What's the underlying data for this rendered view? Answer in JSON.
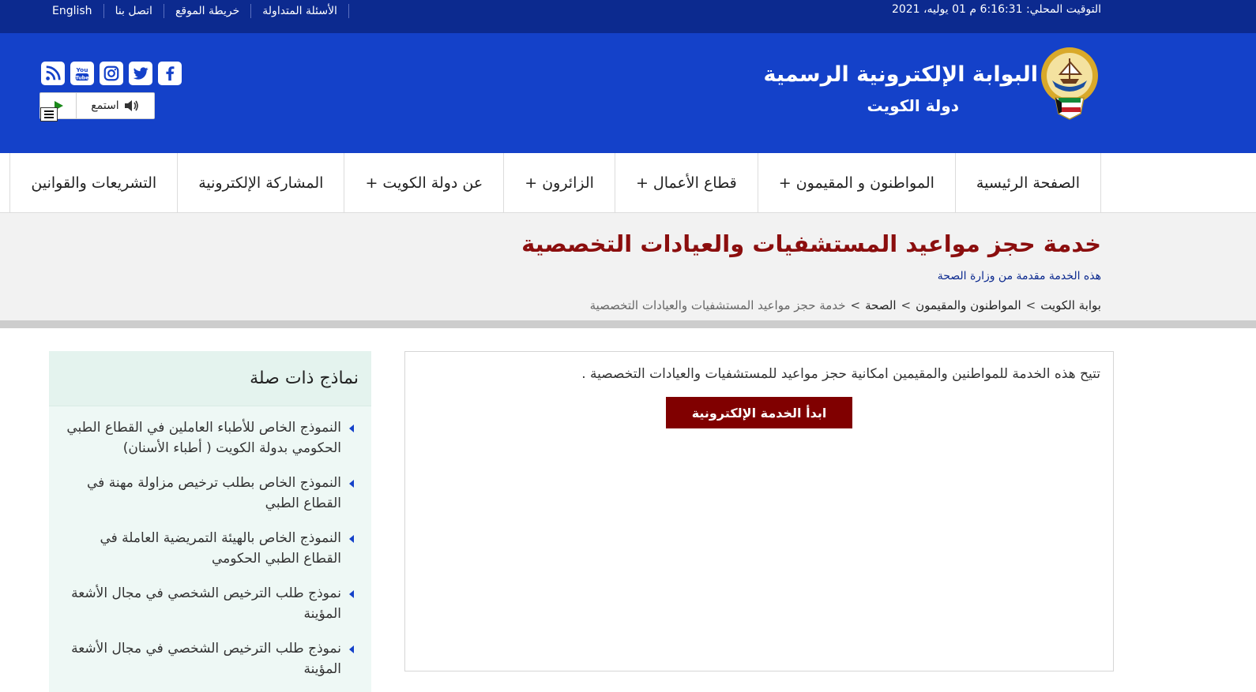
{
  "topbar": {
    "links": [
      "English",
      "اتصل بنا",
      "خريطة الموقع",
      "الأسئلة المتداولة"
    ],
    "local_time": "التوقيت المحلي: 6:16:31 م 01 يوليه، 2021"
  },
  "header": {
    "title": "البوابة الإلكترونية الرسمية",
    "subtitle": "دولة الكويت",
    "listen_label": "استمع",
    "socials": [
      "rss-icon",
      "youtube-icon",
      "instagram-icon",
      "twitter-icon",
      "facebook-icon"
    ],
    "colors": {
      "topbar": "#0c2a8f",
      "header": "#1441c9",
      "accent": "#800000"
    }
  },
  "nav": {
    "items": [
      "الصفحة الرئيسية",
      "المواطنون و المقيمون +",
      "قطاع الأعمال +",
      "الزائرون +",
      "عن دولة الكويت +",
      "المشاركة الإلكترونية",
      "التشريعات والقوانين"
    ]
  },
  "page": {
    "title": "خدمة حجز مواعيد المستشفيات والعيادات التخصصية",
    "provider": "هذه الخدمة مقدمة من وزارة الصحة",
    "breadcrumb": [
      "بوابة الكويت",
      "المواطنون والمقيمون",
      "الصحة",
      "خدمة حجز مواعيد المستشفيات والعيادات التخصصية"
    ],
    "breadcrumb_sep": ">"
  },
  "main": {
    "description": "تتيح هذه الخدمة للمواطنين والمقيمين امكانية حجز مواعيد للمستشفيات والعيادات التخصصية .",
    "start_button": "ابدأ الخدمة الإلكترونية"
  },
  "sidebar": {
    "title": "نماذج ذات صلة",
    "items": [
      "النموذج الخاص للأطباء العاملين في القطاع الطبي الحكومي بدولة الكويت ( أطباء الأسنان)",
      "النموذج الخاص بطلب ترخيص مزاولة مهنة في القطاع الطبي",
      "النموذج الخاص بالهيئة التمريضية العاملة في القطاع الطبي الحكومي",
      "نموذج طلب الترخيص الشخصي في مجال الأشعة المؤينة",
      "نموذج طلب الترخيص الشخصي في مجال الأشعة المؤينة"
    ]
  }
}
